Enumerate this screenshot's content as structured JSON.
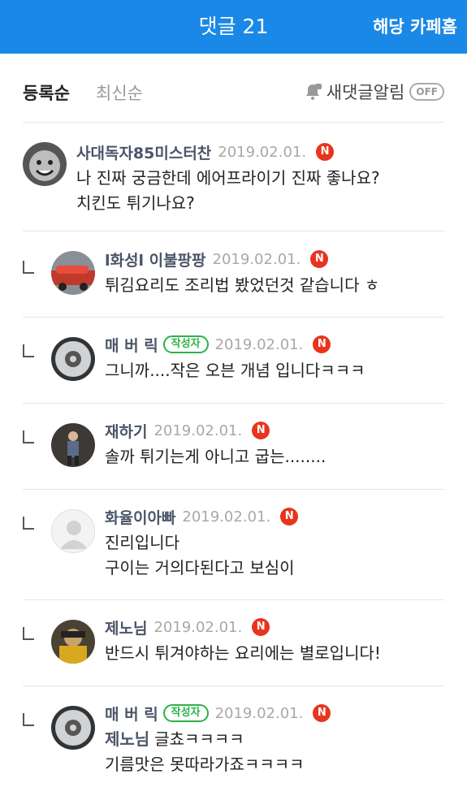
{
  "header": {
    "title": "댓글 21",
    "cafe_link": "해당 카페홈"
  },
  "sortbar": {
    "registered": "등록순",
    "newest": "최신순",
    "alarm_label": "새댓글알림",
    "alarm_toggle": "OFF"
  },
  "comments": [
    {
      "name": "사대독자85미스터찬",
      "date": "2019.02.01.",
      "new_badge": "N",
      "lines": [
        "나 진짜 궁금한데 에어프라이기 진짜 좋나요?",
        "치킨도 튀기나요?"
      ]
    },
    {
      "name": "l화성l 이불팡팡",
      "date": "2019.02.01.",
      "new_badge": "N",
      "lines": [
        "튀김요리도 조리법 봤었던것 같습니다 ㅎ"
      ]
    },
    {
      "name": "매 버 릭",
      "author_badge": "작성자",
      "date": "2019.02.01.",
      "new_badge": "N",
      "lines": [
        "그니까....작은 오븐 개념 입니다ㅋㅋㅋ"
      ]
    },
    {
      "name": "재하기",
      "date": "2019.02.01.",
      "new_badge": "N",
      "lines": [
        "솔까 튀기는게 아니고 굽는........"
      ]
    },
    {
      "name": "화율이아빠",
      "date": "2019.02.01.",
      "new_badge": "N",
      "lines": [
        "진리입니다",
        "구이는 거의다된다고 보심이"
      ]
    },
    {
      "name": "제노님",
      "date": "2019.02.01.",
      "new_badge": "N",
      "lines": [
        "반드시 튀겨야하는 요리에는 별로입니다!"
      ]
    },
    {
      "name": "매 버 릭",
      "author_badge": "작성자",
      "date": "2019.02.01.",
      "new_badge": "N",
      "mention": "제노님",
      "lines": [
        "글쵸ㅋㅋㅋㅋ",
        "기름맛은 못따라가죠ㅋㅋㅋㅋ"
      ]
    }
  ],
  "colors": {
    "header_bg": "#1a88e6",
    "author_badge": "#2bb34a",
    "new_badge": "#e8341e",
    "name": "#4a5568"
  }
}
